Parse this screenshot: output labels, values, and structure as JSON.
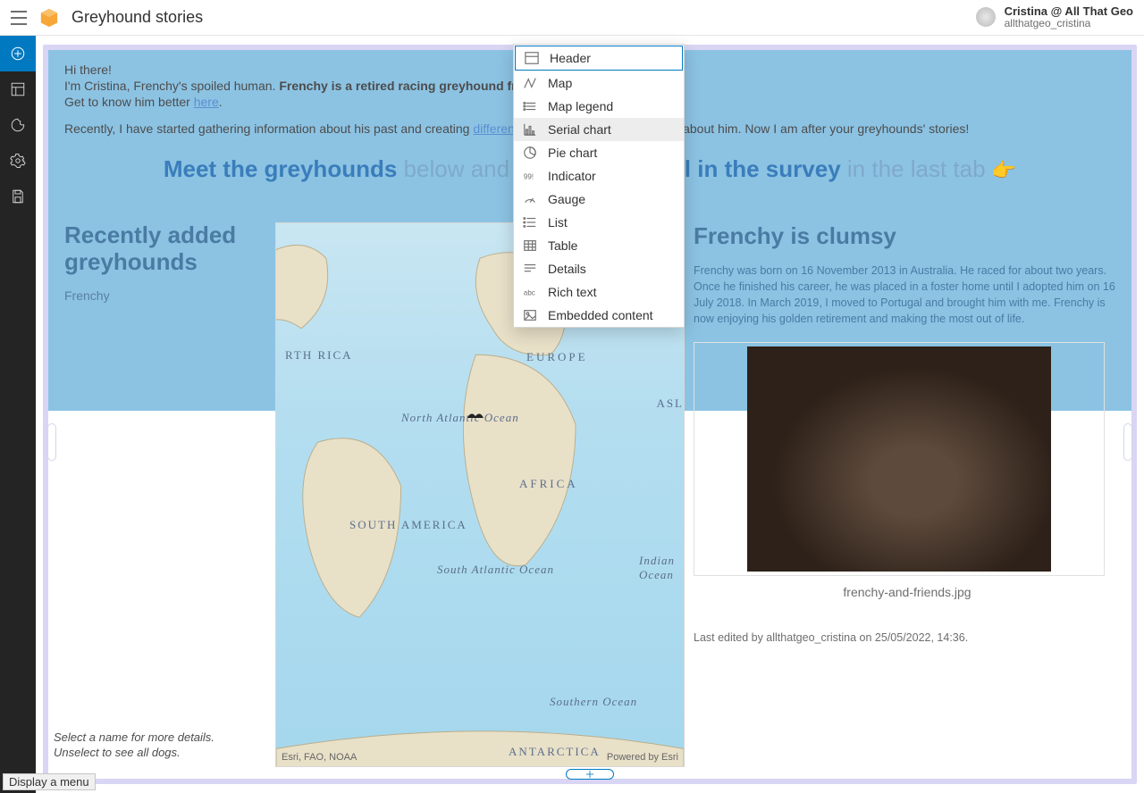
{
  "app": {
    "title": "Greyhound stories"
  },
  "user": {
    "name": "Cristina @ All That Geo",
    "handle": "allthatgeo_cristina"
  },
  "intro": {
    "hi": "Hi there!",
    "line1a": "I'm Cristina, Frenchy's spoiled human. ",
    "line1b": "Frenchy is a retired racing greyhound from Australia.",
    "line2a": "Get to know him better ",
    "line2link": "here",
    "line2b": ".",
    "line3a": "Recently, I have started gathering information about his past and creating ",
    "line3link": "different sorts of information products",
    "line3b": " about him. Now I am after your greyhounds' stories!"
  },
  "headline": {
    "s1": "Meet the greyhounds",
    "l1": " below and don't forget to ",
    "s2": "fill in the survey",
    "l2": " in the last tab "
  },
  "left": {
    "title": "Recently added greyhounds",
    "items": [
      "Frenchy"
    ]
  },
  "map": {
    "attrib": "Esri, FAO, NOAA",
    "powered": "Powered by Esri",
    "labels": {
      "europe": "EUROPE",
      "africa": "AFRICA",
      "southamerica": "SOUTH AMERICA",
      "rica": "RTH RICA",
      "natl": "North Atlantic Ocean",
      "satl": "South Atlantic Ocean",
      "indian": "Indian Ocean",
      "southern": "Southern Ocean",
      "ant": "ANTARCTICA",
      "asl": "ASL"
    }
  },
  "right": {
    "title": "Frenchy is clumsy",
    "body": "Frenchy was born on 16 November 2013 in Australia. He raced for about two years. Once he finished his career, he was placed in a foster home until I adopted him on 16 July 2018. In March 2019, I moved to Portugal and brought him with me. Frenchy is now enjoying his golden retirement and making the most out of life.",
    "caption": "frenchy-and-friends.jpg",
    "lastedit": "Last edited by allthatgeo_cristina on 25/05/2022, 14:36."
  },
  "hint": "Select a name for more details. Unselect to see all dogs.",
  "menu": {
    "items": [
      {
        "label": "Header"
      },
      {
        "label": "Map"
      },
      {
        "label": "Map legend"
      },
      {
        "label": "Serial chart"
      },
      {
        "label": "Pie chart"
      },
      {
        "label": "Indicator"
      },
      {
        "label": "Gauge"
      },
      {
        "label": "List"
      },
      {
        "label": "Table"
      },
      {
        "label": "Details"
      },
      {
        "label": "Rich text"
      },
      {
        "label": "Embedded content"
      }
    ],
    "selectedIndex": 0,
    "hoverIndex": 3
  },
  "status": "Display a menu"
}
